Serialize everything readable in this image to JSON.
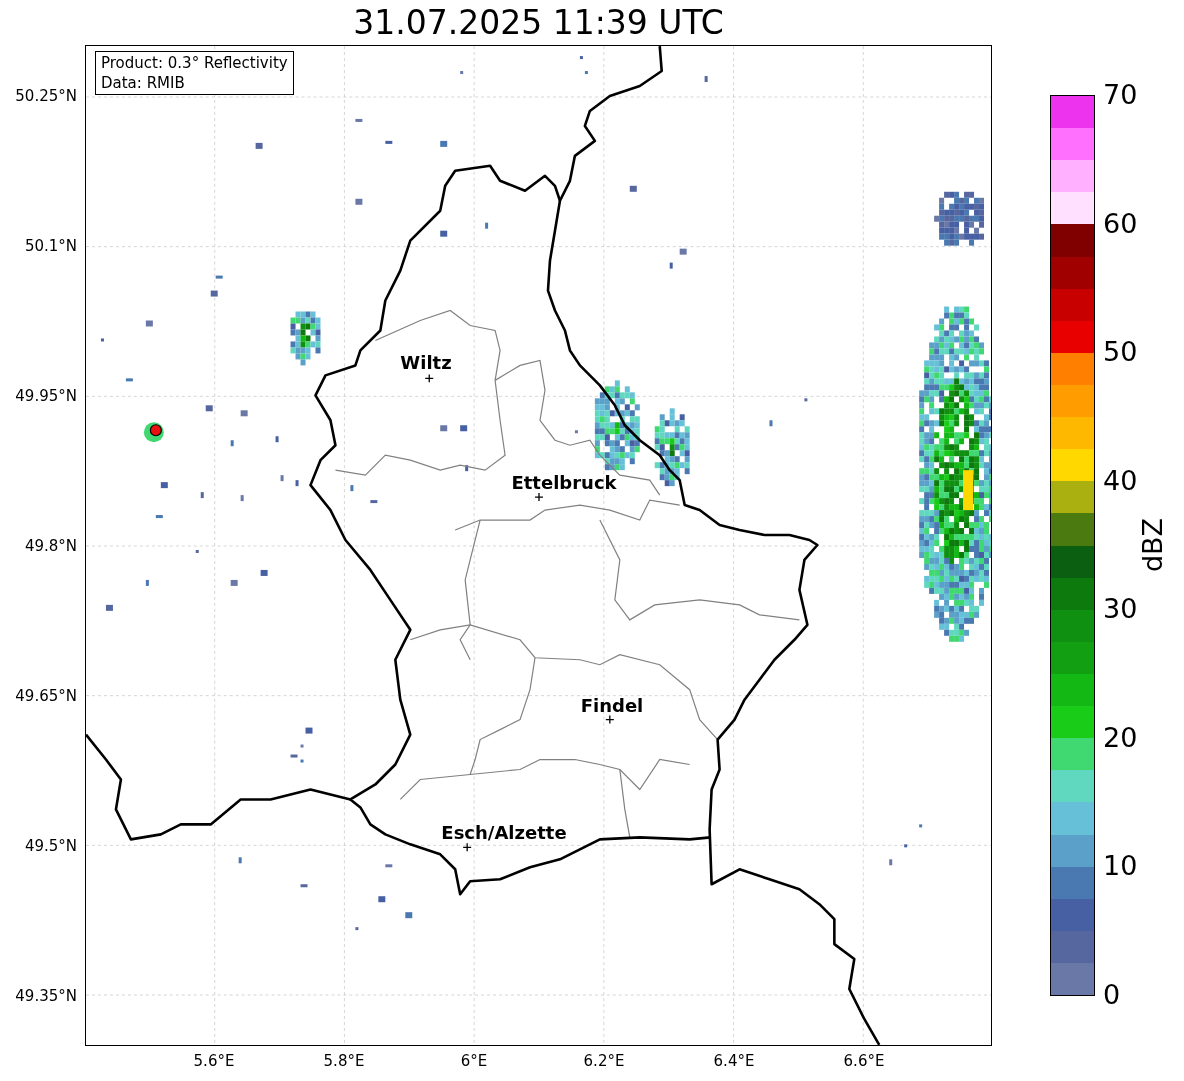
{
  "title": "31.07.2025 11:39 UTC",
  "legend": [
    "Product: 0.3° Reflectivity",
    "Data: RMIB"
  ],
  "yticks": [
    "50.25°N",
    "50.1°N",
    "49.95°N",
    "49.8°N",
    "49.65°N",
    "49.5°N",
    "49.35°N"
  ],
  "xticks": [
    "5.6°E",
    "5.8°E",
    "6°E",
    "6.2°E",
    "6.4°E",
    "6.6°E"
  ],
  "cities": [
    {
      "name": "Wiltz"
    },
    {
      "name": "Ettelbruck"
    },
    {
      "name": "Findel"
    },
    {
      "name": "Esch/Alzette"
    }
  ],
  "colorbar": {
    "label": "dBZ",
    "ticks": [
      "70",
      "60",
      "50",
      "40",
      "30",
      "20",
      "10",
      "0"
    ],
    "bins": [
      {
        "color": "#ee33ee"
      },
      {
        "color": "#ff70ff"
      },
      {
        "color": "#ffb0ff"
      },
      {
        "color": "#ffe0ff"
      },
      {
        "color": "#800000"
      },
      {
        "color": "#a00000"
      },
      {
        "color": "#c80000"
      },
      {
        "color": "#e80000"
      },
      {
        "color": "#ff8000"
      },
      {
        "color": "#ff9c00"
      },
      {
        "color": "#ffb800"
      },
      {
        "color": "#ffd800"
      },
      {
        "color": "#aab010"
      },
      {
        "color": "#4a7a10"
      },
      {
        "color": "#0a6010"
      },
      {
        "color": "#0c7a0c"
      },
      {
        "color": "#109010"
      },
      {
        "color": "#12a012"
      },
      {
        "color": "#14b814"
      },
      {
        "color": "#18cc18"
      },
      {
        "color": "#40d870"
      },
      {
        "color": "#60d8c0"
      },
      {
        "color": "#66c0d8"
      },
      {
        "color": "#5aa0c8"
      },
      {
        "color": "#4a78b0"
      },
      {
        "color": "#4660a3"
      },
      {
        "color": "#56679f"
      },
      {
        "color": "#6a78a8"
      }
    ]
  }
}
